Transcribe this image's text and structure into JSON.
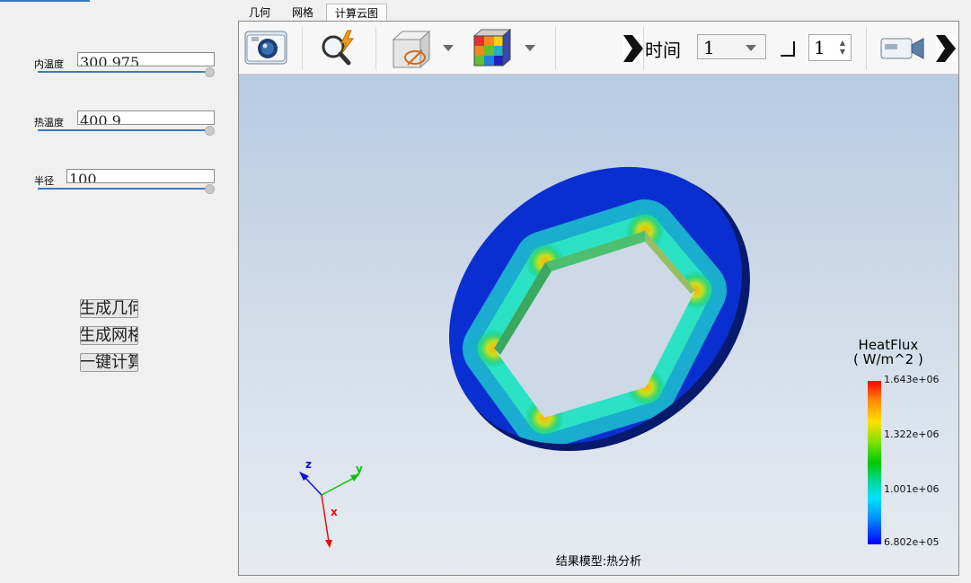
{
  "left_panel": {
    "params": [
      {
        "label": "内温度",
        "value": "300.975",
        "progress": 1.0
      },
      {
        "label": "热温度",
        "value": "400.9",
        "progress": 1.0
      },
      {
        "label": "半径",
        "value": "100",
        "progress": 1.0
      }
    ],
    "buttons": [
      {
        "label": "生成几何"
      },
      {
        "label": "生成网格"
      },
      {
        "label": "一键计算"
      }
    ]
  },
  "tabs": [
    {
      "label": "几何",
      "active": false
    },
    {
      "label": "网格",
      "active": false
    },
    {
      "label": "计算云图",
      "active": true
    }
  ],
  "toolbar": {
    "icons": [
      "camera-icon",
      "magnifier-lightning-icon",
      "cube-visibility-icon",
      "colormap-cube-icon",
      "play-icon",
      "video-camera-icon"
    ],
    "time_label": "时间",
    "time_value": "1",
    "step_value": "1"
  },
  "viewer": {
    "caption": "结果模型:热分析",
    "axes": {
      "z": "z",
      "y": "y",
      "x": "x"
    },
    "legend": {
      "title": "HeatFlux",
      "unit": "( W/m^2 )",
      "ticks": [
        "1.643e+06",
        "1.322e+06",
        "1.001e+06",
        "6.802e+05"
      ]
    }
  },
  "colors": {
    "accent": "#3e79bd",
    "ring_base": "#0a2fd0",
    "hot_spot": "#ffb000"
  }
}
